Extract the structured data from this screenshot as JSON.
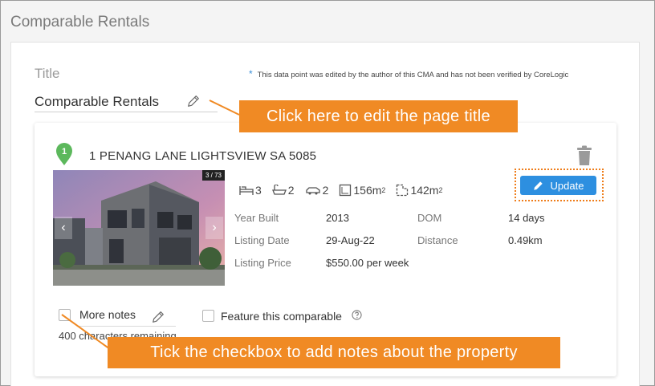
{
  "section": {
    "title": "Comparable Rentals"
  },
  "title_field": {
    "label": "Title",
    "value": "Comparable Rentals",
    "disclaimer_star": "*",
    "disclaimer": "This data point was edited by the author of this CMA and has not been verified by CoreLogic"
  },
  "property": {
    "pin_number": "1",
    "address": "1 PENANG LANE LIGHTSVIEW SA 5085",
    "photo_counter": "3 / 73",
    "features": {
      "beds": "3",
      "baths": "2",
      "cars": "2",
      "land_size": "156m",
      "floor_size": "142m",
      "unit_superscript": "2"
    },
    "details": {
      "year_built_label": "Year Built",
      "year_built": "2013",
      "dom_label": "DOM",
      "dom": "14 days",
      "listing_date_label": "Listing Date",
      "listing_date": "29-Aug-22",
      "distance_label": "Distance",
      "distance": "0.49km",
      "listing_price_label": "Listing Price",
      "listing_price": "$550.00 per week"
    },
    "update_label": "Update",
    "more_notes_label": "More notes",
    "feature_label": "Feature this comparable",
    "chars_remaining": "400 characters remaining"
  },
  "callouts": {
    "edit_title": "Click here to edit the page title",
    "tick_checkbox": "Tick the checkbox to add notes about the property"
  },
  "colors": {
    "accent_orange": "#f08a24",
    "button_blue": "#2d8fe0",
    "pin_green": "#5cb85c"
  },
  "icons": [
    "pencil-icon",
    "map-pin-icon",
    "trash-icon",
    "bed-icon",
    "bath-icon",
    "car-icon",
    "land-size-icon",
    "floor-size-icon",
    "help-icon",
    "chevron-left-icon",
    "chevron-right-icon"
  ]
}
